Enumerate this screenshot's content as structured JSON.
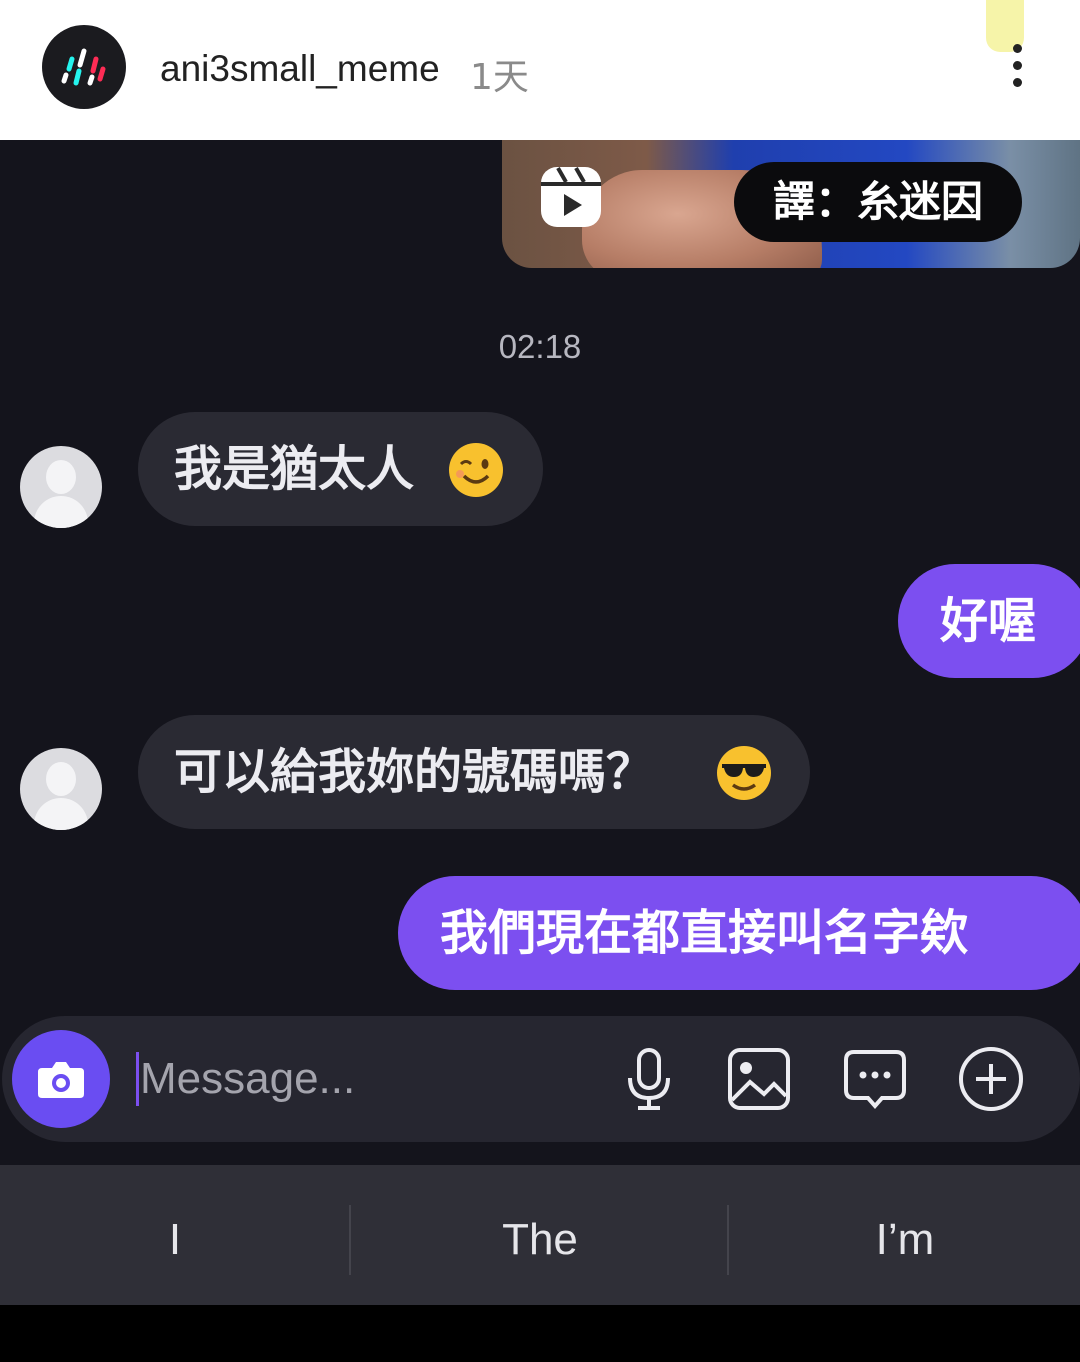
{
  "post_header": {
    "username": "ani3small_meme",
    "time_ago": "1天",
    "avatar_icon": "brand-logo-icon",
    "more_icon": "more-vertical-icon"
  },
  "shared_reel": {
    "icon": "reels-play-icon",
    "caption_tag": "譯：糸迷因"
  },
  "timestamp": "02:18",
  "messages": [
    {
      "direction": "incoming",
      "text": "我是猶太人",
      "emoji": "winking-face-emoji"
    },
    {
      "direction": "outgoing",
      "text": "好喔"
    },
    {
      "direction": "incoming",
      "text": "可以給我妳的號碼嗎？",
      "emoji": "sunglasses-face-emoji"
    },
    {
      "direction": "outgoing",
      "text": "我們現在都直接叫名字欸"
    }
  ],
  "composer": {
    "placeholder": "Message...",
    "icons": [
      "camera-icon",
      "microphone-icon",
      "image-icon",
      "sticker-chat-icon",
      "plus-circle-icon"
    ]
  },
  "keyboard_suggestions": [
    "I",
    "The",
    "I’m"
  ],
  "colors": {
    "background": "#14141c",
    "incoming_bubble": "#2a2a33",
    "outgoing_bubble": "#7c4ff0",
    "camera_button": "#6a4df2"
  }
}
